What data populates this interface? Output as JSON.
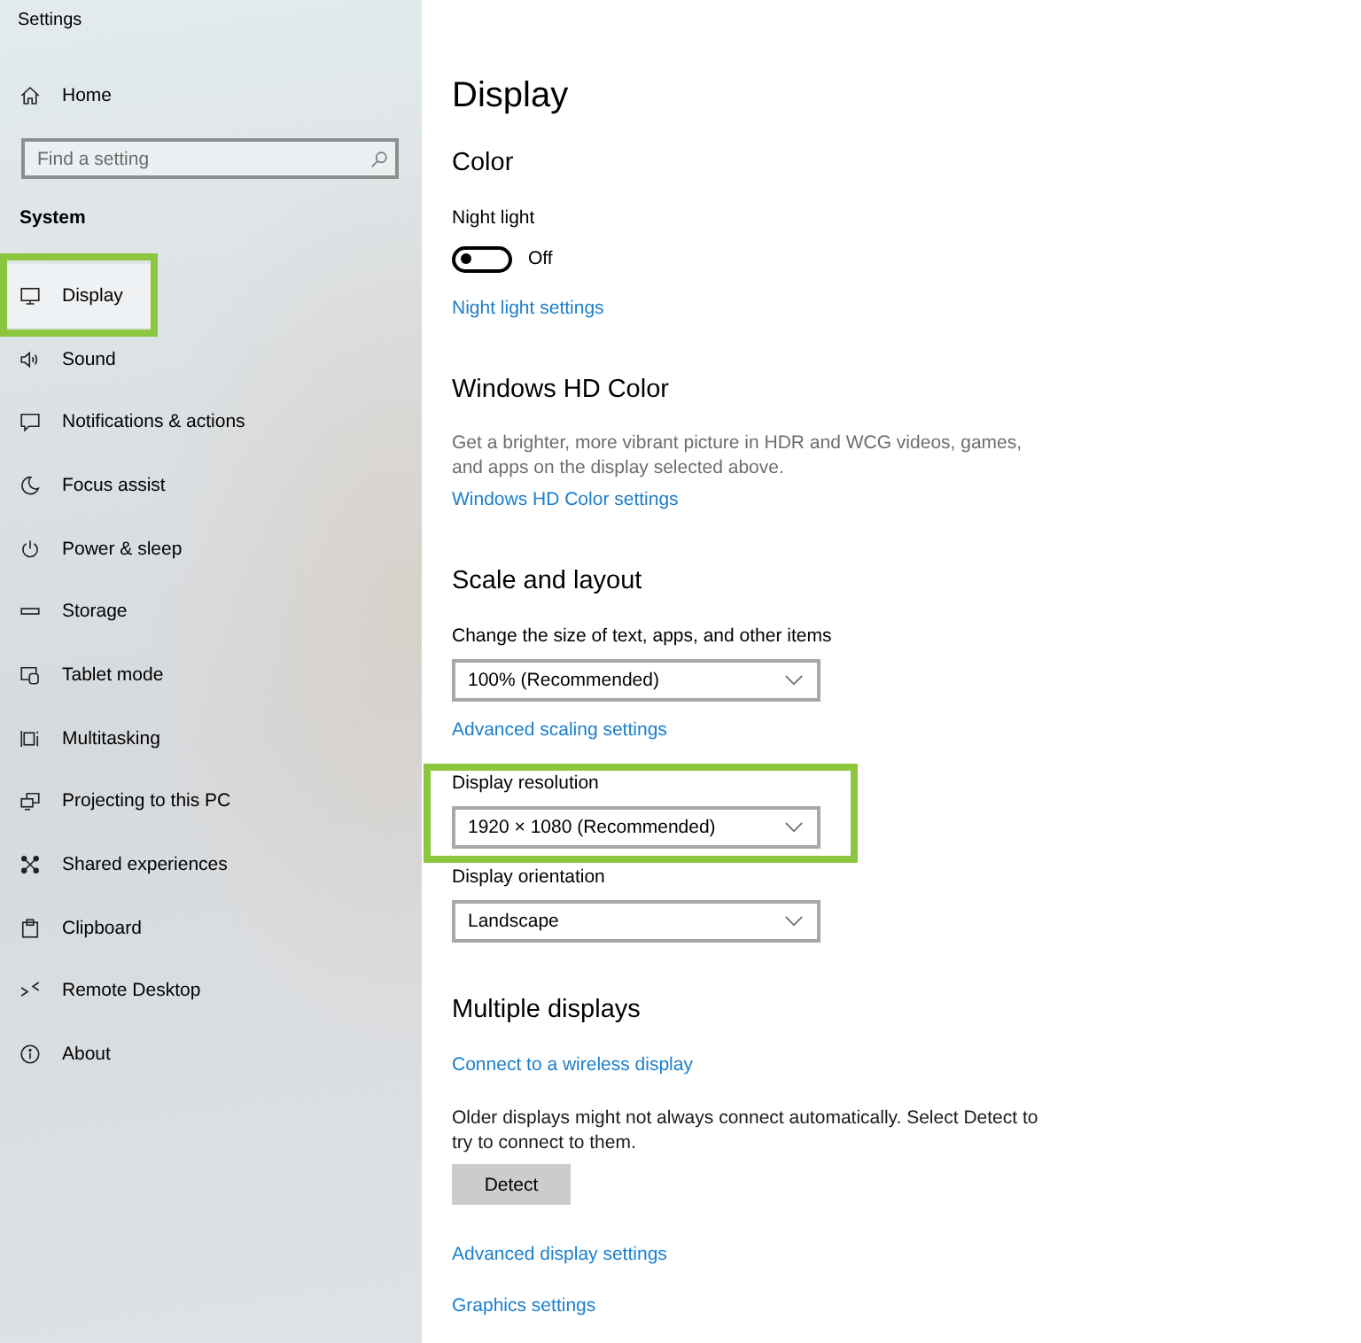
{
  "window": {
    "title": "Settings"
  },
  "sidebar": {
    "home": "Home",
    "search": {
      "placeholder": "Find a setting"
    },
    "section": "System",
    "items": [
      {
        "label": "Display",
        "selected": true,
        "highlighted": true
      },
      {
        "label": "Sound",
        "selected": false,
        "highlighted": false
      },
      {
        "label": "Notifications & actions",
        "selected": false,
        "highlighted": false
      },
      {
        "label": "Focus assist",
        "selected": false,
        "highlighted": false
      },
      {
        "label": "Power & sleep",
        "selected": false,
        "highlighted": false
      },
      {
        "label": "Storage",
        "selected": false,
        "highlighted": false
      },
      {
        "label": "Tablet mode",
        "selected": false,
        "highlighted": false
      },
      {
        "label": "Multitasking",
        "selected": false,
        "highlighted": false
      },
      {
        "label": "Projecting to this PC",
        "selected": false,
        "highlighted": false
      },
      {
        "label": "Shared experiences",
        "selected": false,
        "highlighted": false
      },
      {
        "label": "Clipboard",
        "selected": false,
        "highlighted": false
      },
      {
        "label": "Remote Desktop",
        "selected": false,
        "highlighted": false
      },
      {
        "label": "About",
        "selected": false,
        "highlighted": false
      }
    ]
  },
  "page": {
    "title": "Display",
    "sections": [
      {
        "title": "Color",
        "items": [
          {
            "kind": "label",
            "text": "Night light"
          },
          {
            "kind": "toggle",
            "on": false,
            "state_text": "Off"
          },
          {
            "kind": "link",
            "text": "Night light settings"
          }
        ]
      },
      {
        "title": "Windows HD Color",
        "items": [
          {
            "kind": "text",
            "muted": true,
            "text": "Get a brighter, more vibrant picture in HDR and WCG videos, games, and apps on the display selected above."
          },
          {
            "kind": "link",
            "text": "Windows HD Color settings"
          }
        ]
      },
      {
        "title": "Scale and layout",
        "items": [
          {
            "kind": "dropdown",
            "label": "Change the size of text, apps, and other items",
            "value": "100% (Recommended)",
            "highlighted": false
          },
          {
            "kind": "link",
            "text": "Advanced scaling settings"
          },
          {
            "kind": "dropdown",
            "label": "Display resolution",
            "value": "1920 × 1080 (Recommended)",
            "highlighted": true
          },
          {
            "kind": "dropdown",
            "label": "Display orientation",
            "value": "Landscape",
            "highlighted": false
          }
        ]
      },
      {
        "title": "Multiple displays",
        "items": [
          {
            "kind": "link",
            "text": "Connect to a wireless display"
          },
          {
            "kind": "text",
            "muted": false,
            "text": "Older displays might not always connect automatically. Select Detect to try to connect to them."
          },
          {
            "kind": "button",
            "text": "Detect"
          },
          {
            "kind": "link",
            "text": "Advanced display settings"
          },
          {
            "kind": "link",
            "text": "Graphics settings"
          }
        ]
      }
    ]
  }
}
